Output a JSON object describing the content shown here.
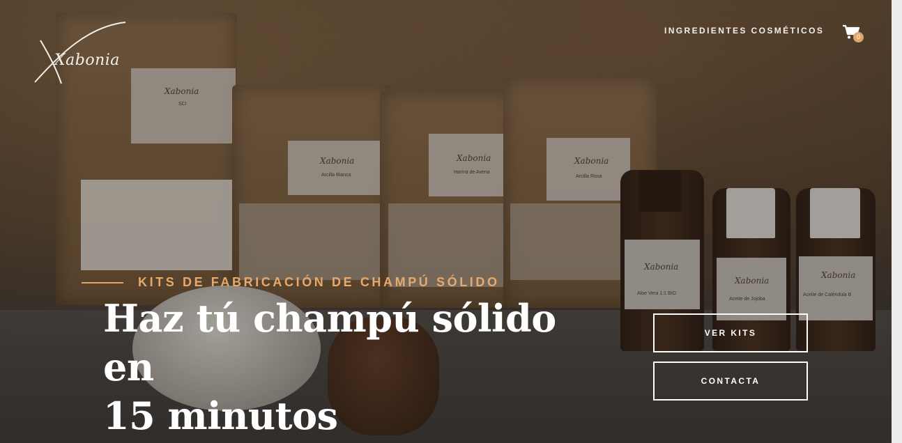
{
  "brand": {
    "logo_text": "Xabonia"
  },
  "nav": {
    "link_label": "INGREDIENTES COSMÉTICOS",
    "cart_count": "0"
  },
  "hero": {
    "eyebrow": "KITS DE FABRICACIÓN DE CHAMPÚ SÓLIDO",
    "headline_line1": "Haz tú champú sólido en",
    "headline_line2": "15 minutos"
  },
  "buttons": {
    "see_kits": "VER KITS",
    "contact": "CONTACTA"
  },
  "product_labels": [
    "Xabonia",
    "SCI",
    "Xabonia",
    "Arcilla Blanca",
    "Xabonia",
    "Harina de Avena",
    "Xabonia",
    "Arcilla Rosa",
    "Xabonia",
    "Aloe Vera 1:1 BIO",
    "Xabonia",
    "Aceite de Jojoba",
    "Xabonia",
    "Aceite de Caléndula B"
  ],
  "colors": {
    "accent": "#e1a46a",
    "text": "#ffffff"
  },
  "icons": {
    "cart": "shopping-cart-icon"
  }
}
